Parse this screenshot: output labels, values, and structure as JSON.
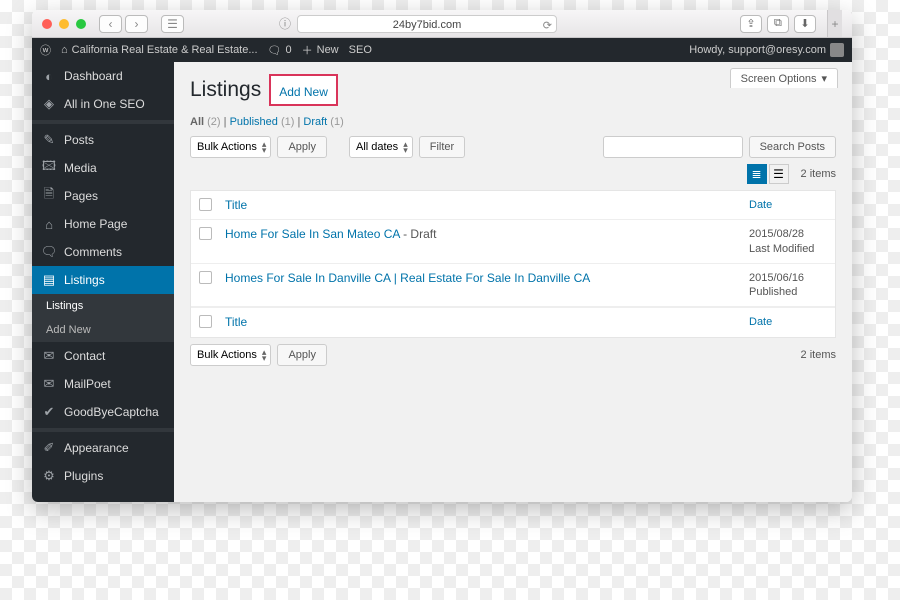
{
  "browser": {
    "url": "24by7bid.com"
  },
  "adminbar": {
    "site": "California Real Estate & Real Estate...",
    "comments": "0",
    "new": "New",
    "seo": "SEO",
    "howdy": "Howdy, support@oresy.com"
  },
  "sidebar": {
    "dashboard": "Dashboard",
    "aioseo": "All in One SEO",
    "posts": "Posts",
    "media": "Media",
    "pages": "Pages",
    "home": "Home Page",
    "comments": "Comments",
    "listings": "Listings",
    "sub_listings": "Listings",
    "sub_addnew": "Add New",
    "contact": "Contact",
    "mailpoet": "MailPoet",
    "captcha": "GoodByeCaptcha",
    "appearance": "Appearance",
    "plugins": "Plugins"
  },
  "page": {
    "title": "Listings",
    "add_new": "Add New",
    "screen_options": "Screen Options"
  },
  "filters": {
    "all": "All",
    "all_count": "(2)",
    "published": "Published",
    "published_count": "(1)",
    "draft": "Draft",
    "draft_count": "(1)",
    "divider": " | "
  },
  "actions": {
    "bulk": "Bulk Actions",
    "apply": "Apply",
    "dates": "All dates",
    "filter": "Filter",
    "search": "Search Posts",
    "items": "2 items"
  },
  "table": {
    "title_hdr": "Title",
    "date_hdr": "Date",
    "rows": [
      {
        "title": "Home For Sale In San Mateo CA",
        "status": " - Draft",
        "date": "2015/08/28",
        "meta": "Last Modified"
      },
      {
        "title": "Homes For Sale In Danville CA | Real Estate For Sale In Danville CA",
        "status": "",
        "date": "2015/06/16",
        "meta": "Published"
      }
    ]
  }
}
